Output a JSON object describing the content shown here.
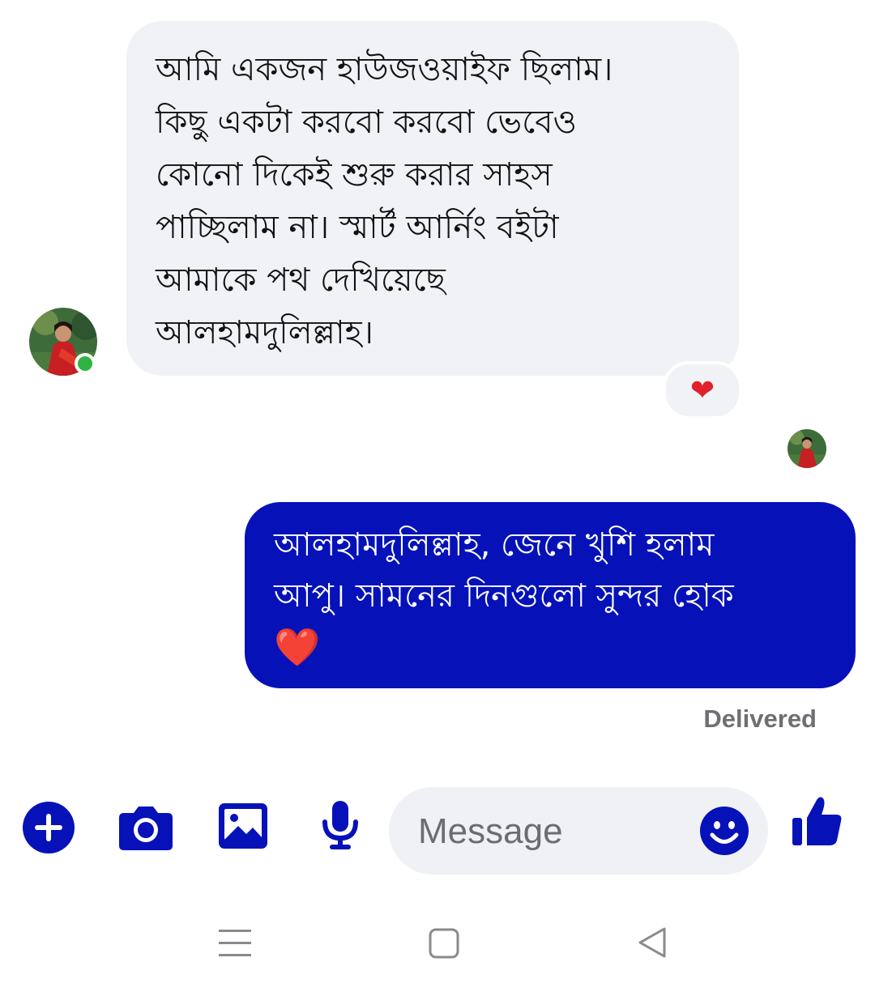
{
  "conversation": {
    "incoming": {
      "lines": [
        "আমি একজন হাউজওয়াইফ ছিলাম।",
        "কিছু একটা করবো করবো ভেবেও",
        "কোনো দিকেই শুরু করার সাহস",
        "পাচ্ছিলাম না। স্মার্ট আর্নিং বইটা",
        "আমাকে পথ দেখিয়েছে",
        "আলহামদুলিল্লাহ।"
      ],
      "reaction": "❤",
      "online": true
    },
    "outgoing": {
      "lines": [
        "আলহামদুলিল্লাহ, জেনে খুশি হলাম",
        "আপু। সামনের দিনগুলো সুন্দর হোক"
      ],
      "emoji": "❤️",
      "status": "Delivered"
    }
  },
  "composer": {
    "placeholder": "Message",
    "icons": [
      "plus-icon",
      "camera-icon",
      "image-icon",
      "microphone-icon",
      "emoji-icon",
      "thumbs-up-icon"
    ],
    "accent_color": "#0612b8"
  },
  "nav_bar": {
    "icons": [
      "menu-icon",
      "home-icon",
      "back-icon"
    ]
  }
}
